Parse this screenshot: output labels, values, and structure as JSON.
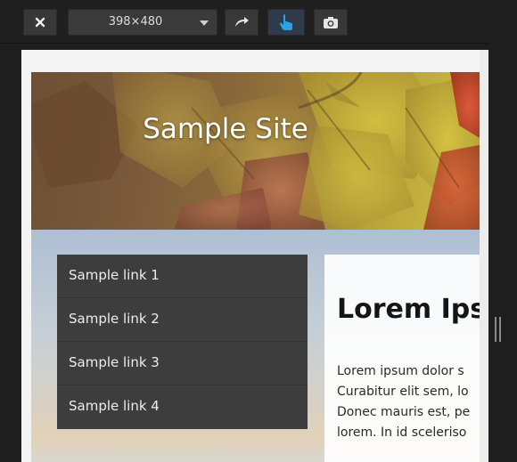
{
  "toolbar": {
    "close_icon": "close-icon",
    "size_value": "398×480",
    "rotate_icon": "rotate-icon",
    "touch_icon": "touch-icon",
    "screenshot_icon": "camera-icon"
  },
  "site": {
    "title": "Sample Site",
    "nav": [
      "Sample link 1",
      "Sample link 2",
      "Sample link 3",
      "Sample link 4"
    ],
    "content": {
      "heading": "Lorem Ips",
      "lines": [
        "Lorem ipsum dolor s",
        "Curabitur elit sem, lo",
        "Donec mauris est, pe",
        "lorem. In id sceleriso"
      ]
    }
  },
  "colors": {
    "toolbar_bg": "#1f1f1f",
    "nav_bg": "#3d3d3d",
    "touch_active": "#2aa3e6"
  }
}
